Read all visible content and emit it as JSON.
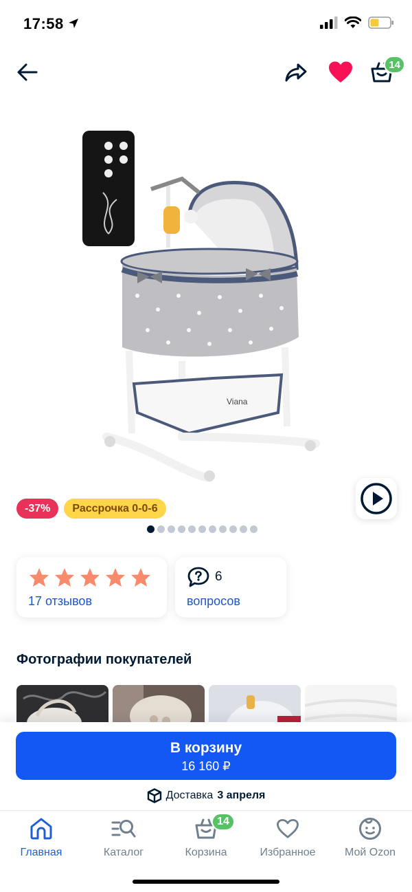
{
  "status_bar": {
    "time": "17:58"
  },
  "header": {
    "cart_count": "14"
  },
  "product": {
    "badges": {
      "discount": "-37%",
      "installment": "Рассрочка 0-0-6"
    },
    "photo_count": 11,
    "active_photo": 1
  },
  "reviews": {
    "label": "17 отзывов",
    "rating": 5
  },
  "questions": {
    "count": "6",
    "label": "вопросов"
  },
  "customer_photos": {
    "title": "Фотографии покупателей"
  },
  "purchase": {
    "button_label": "В корзину",
    "price": "16 160 ₽",
    "delivery_prefix": "Доставка",
    "delivery_date": "3 апреля"
  },
  "tab_bar": {
    "items": [
      {
        "label": "Главная",
        "icon": "home-icon",
        "active": true
      },
      {
        "label": "Каталог",
        "icon": "catalog-search-icon",
        "active": false
      },
      {
        "label": "Корзина",
        "icon": "cart-icon",
        "active": false,
        "badge": "14"
      },
      {
        "label": "Избранное",
        "icon": "heart-icon",
        "active": false
      },
      {
        "label": "Мой Ozon",
        "icon": "profile-face-icon",
        "active": false
      }
    ]
  },
  "colors": {
    "accent": "#1358f5",
    "favorite": "#f91155",
    "badge_green": "#56c265",
    "star": "#f98a6b"
  }
}
